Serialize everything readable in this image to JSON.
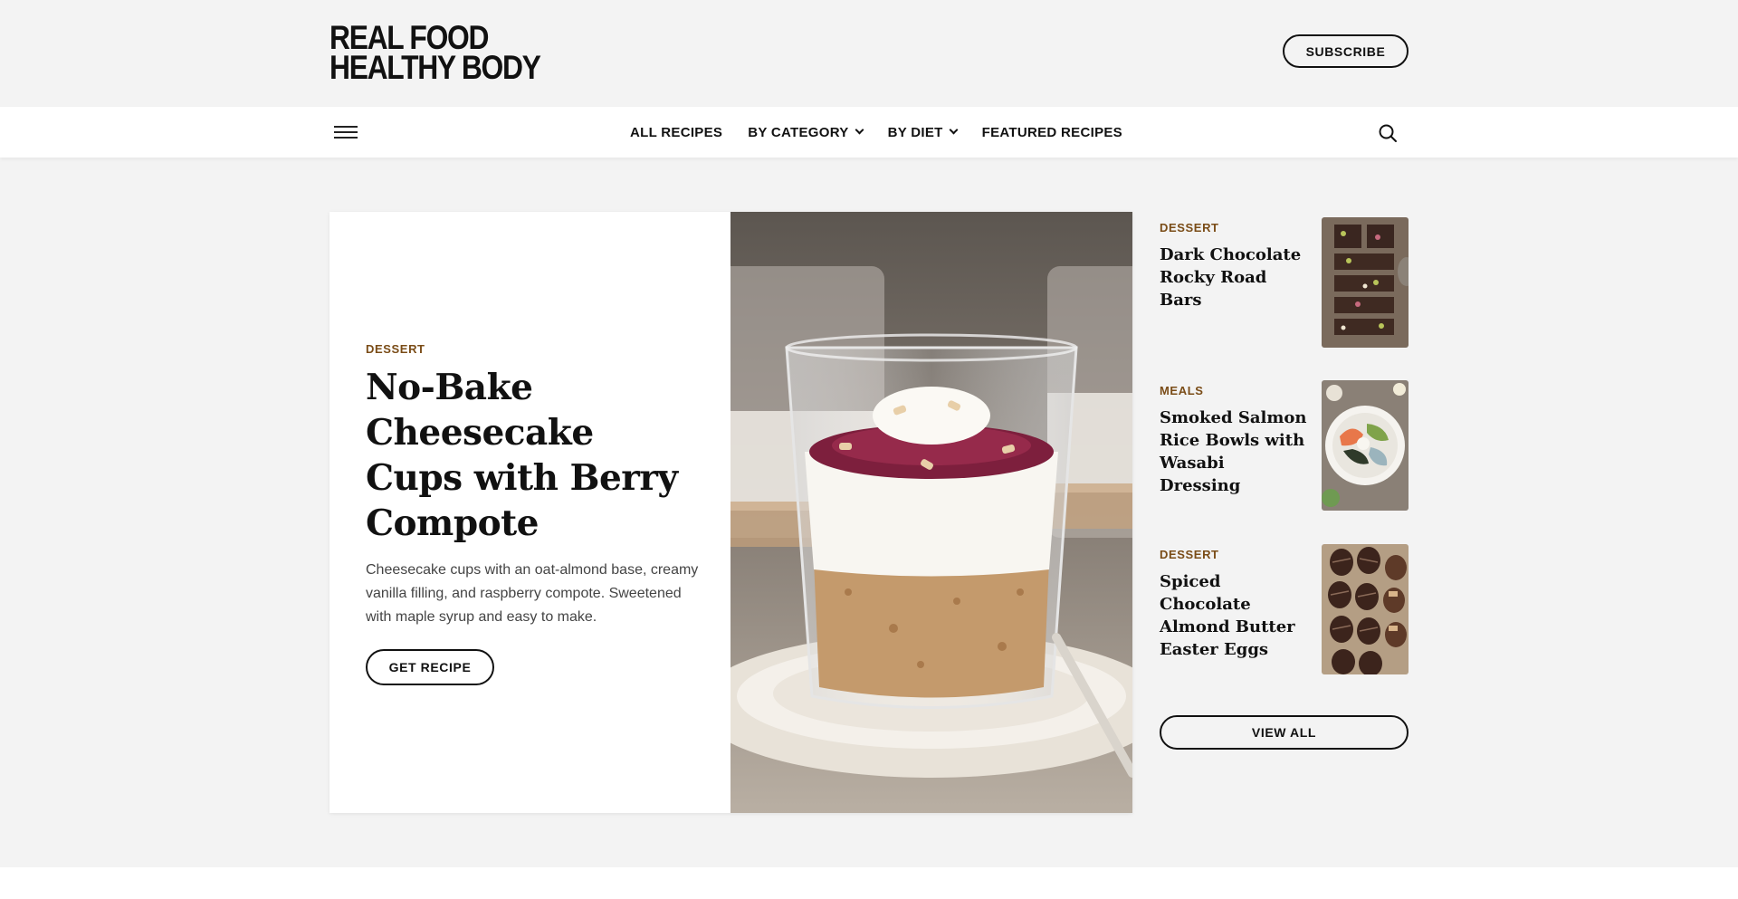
{
  "header": {
    "logo_line1": "REAL FOOD",
    "logo_line2": "HEALTHY BODY",
    "subscribe_label": "SUBSCRIBE"
  },
  "nav": {
    "menu_icon": "hamburger-menu-icon",
    "items": [
      {
        "label": "ALL RECIPES",
        "dropdown": false
      },
      {
        "label": "BY CATEGORY",
        "dropdown": true
      },
      {
        "label": "BY DIET",
        "dropdown": true
      },
      {
        "label": "FEATURED RECIPES",
        "dropdown": false
      }
    ],
    "search_icon": "search-icon"
  },
  "featured": {
    "category": "DESSERT",
    "title": "No-Bake Cheesecake Cups with Berry Compote",
    "description": "Cheesecake cups with an oat-almond base, creamy vanilla filling, and raspberry compote. Sweetened with maple syrup and easy to make.",
    "button_label": "GET RECIPE",
    "image": "cheesecake-cup-photo"
  },
  "sidebar": {
    "items": [
      {
        "category": "DESSERT",
        "title": "Dark Chocolate Rocky Road Bars",
        "image": "rocky-road-bars-photo"
      },
      {
        "category": "MEALS",
        "title": "Smoked Salmon Rice Bowls with Wasabi Dressing",
        "image": "salmon-rice-bowl-photo"
      },
      {
        "category": "DESSERT",
        "title": "Spiced Chocolate Almond Butter Easter Eggs",
        "image": "chocolate-easter-eggs-photo"
      }
    ],
    "view_all_label": "VIEW ALL"
  },
  "colors": {
    "background": "#f3f3f3",
    "category_accent": "#7a4c17",
    "text": "#111111"
  }
}
